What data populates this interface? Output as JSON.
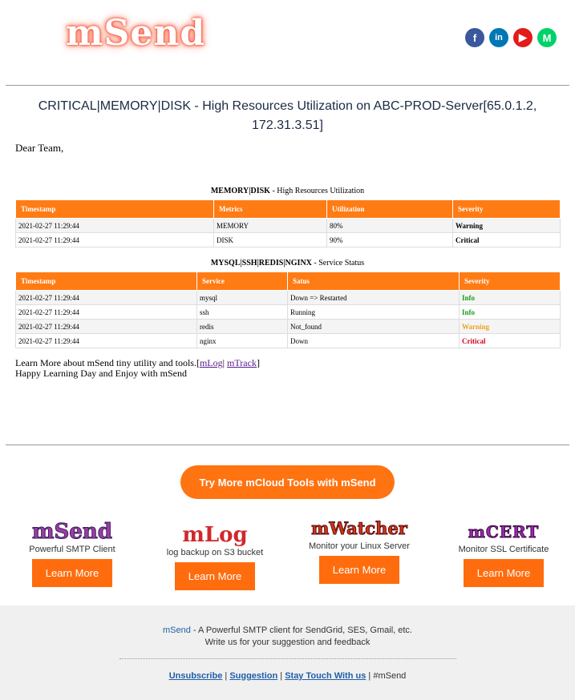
{
  "brand": {
    "logo": "mSend"
  },
  "social": [
    {
      "name": "facebook-icon",
      "glyph": "f"
    },
    {
      "name": "linkedin-icon",
      "glyph": "in"
    },
    {
      "name": "youtube-icon",
      "glyph": "▶"
    },
    {
      "name": "medium-icon",
      "glyph": "M"
    }
  ],
  "email": {
    "title": "CRITICAL|MEMORY|DISK - High Resources Utilization on ABC-PROD-Server[65.0.1.2, 172.31.3.51]",
    "greeting": "Dear Team,",
    "section1": {
      "bold": "MEMORY|DISK",
      "rest": " - High Resources Utilization"
    },
    "table1": {
      "headers": [
        "Timestamp",
        "Metrics",
        "Utilization",
        "Severity"
      ],
      "rows": [
        [
          "2021-02-27 11:29:44",
          "MEMORY",
          "80%",
          "Warning"
        ],
        [
          "2021-02-27 11:29:44",
          "DISK",
          "90%",
          "Critical"
        ]
      ]
    },
    "section2": {
      "bold": "MYSQL|SSH|REDIS|NGINX",
      "rest": " - Service Status"
    },
    "table2": {
      "headers": [
        "Timestamp",
        "Service",
        "Satus",
        "Severity"
      ],
      "rows": [
        [
          "2021-02-27 11:29:44",
          "mysql",
          "Down => Restarted",
          "Info"
        ],
        [
          "2021-02-27 11:29:44",
          "ssh",
          "Running",
          "Info"
        ],
        [
          "2021-02-27 11:29:44",
          "redis",
          "Not_found",
          "Warning"
        ],
        [
          "2021-02-27 11:29:44",
          "nginx",
          "Down",
          "Critical"
        ]
      ]
    },
    "learn_more": "Learn More about mSend tiny utility and tools.[",
    "mlog_link": "mLog",
    "sep": "| ",
    "mtrack_link": "mTrack",
    "close_bracket": "]",
    "happy": "Happy Learning Day and Enjoy with mSend"
  },
  "cta": {
    "label": "Try  More mCloud Tools with mSend"
  },
  "tools": [
    {
      "logo": "mSend",
      "desc": "Powerful SMTP Client",
      "button": "Learn More",
      "color": "#9a3fa0"
    },
    {
      "logo": "mLog",
      "desc": "log backup on S3 bucket",
      "button": "Learn More",
      "color": "#d0282a"
    },
    {
      "logo": "mWatcher",
      "desc": "Monitor your Linux Server",
      "button": "Learn More",
      "color": "#d4321a"
    },
    {
      "logo": "mCERT",
      "desc": "Monitor SSL Certificate",
      "button": "Learn More",
      "color": "#9a2ab0"
    }
  ],
  "footer": {
    "brand_link": "mSend",
    "line1_rest": " - A Powerful  SMTP client for SendGrid, SES, Gmail, etc.",
    "line2": "Write us for your suggestion and feedback",
    "unsubscribe": "Unsubscribe",
    "suggestion": "Suggestion",
    "stay": "Stay Touch With us",
    "hashtag": "#mSend",
    "sep1": "| ",
    "sep2": " | ",
    "sep3": " |  "
  }
}
